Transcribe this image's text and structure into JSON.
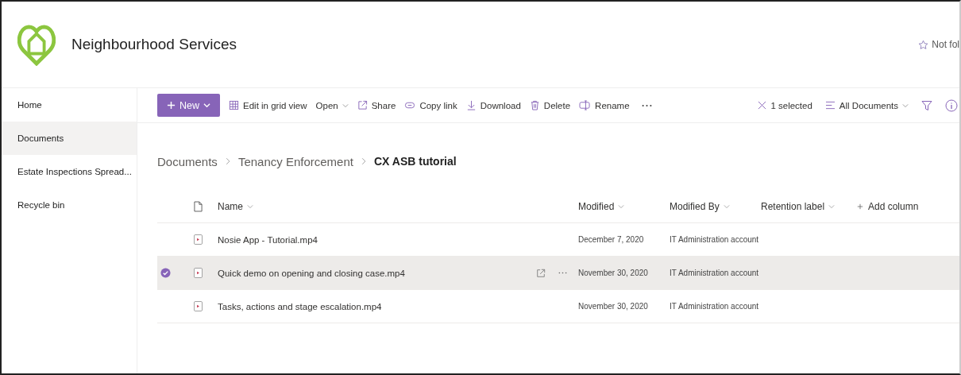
{
  "site": {
    "title": "Neighbourhood Services",
    "follow": "Not fol"
  },
  "nav": [
    {
      "label": "Home",
      "selected": false
    },
    {
      "label": "Documents",
      "selected": true
    },
    {
      "label": "Estate Inspections Spread...",
      "selected": false
    },
    {
      "label": "Recycle bin",
      "selected": false
    }
  ],
  "toolbar": {
    "new_label": "New",
    "items": [
      {
        "kind": "grid",
        "label": "Edit in grid view"
      },
      {
        "kind": "open",
        "label": "Open"
      },
      {
        "kind": "share",
        "label": "Share"
      },
      {
        "kind": "link",
        "label": "Copy link"
      },
      {
        "kind": "download",
        "label": "Download"
      },
      {
        "kind": "delete",
        "label": "Delete"
      },
      {
        "kind": "rename",
        "label": "Rename"
      }
    ],
    "selection": "1 selected",
    "view": "All Documents"
  },
  "breadcrumb": [
    "Documents",
    "Tenancy Enforcement",
    "CX ASB tutorial"
  ],
  "columns": [
    {
      "kind": "sort",
      "label": "Name"
    },
    {
      "kind": "sort",
      "label": "Modified"
    },
    {
      "kind": "sort",
      "label": "Modified By"
    },
    {
      "kind": "sort",
      "label": "Retention label"
    },
    {
      "kind": "add",
      "label": "Add column"
    }
  ],
  "rows": [
    {
      "name": "Nosie App - Tutorial.mp4",
      "modified": "December 7, 2020",
      "modified_by": "IT Administration account",
      "selected": false
    },
    {
      "name": "Quick demo on opening and closing case.mp4",
      "modified": "November 30, 2020",
      "modified_by": "IT Administration account",
      "selected": true
    },
    {
      "name": "Tasks, actions and stage escalation.mp4",
      "modified": "November 30, 2020",
      "modified_by": "IT Administration account",
      "selected": false
    }
  ]
}
